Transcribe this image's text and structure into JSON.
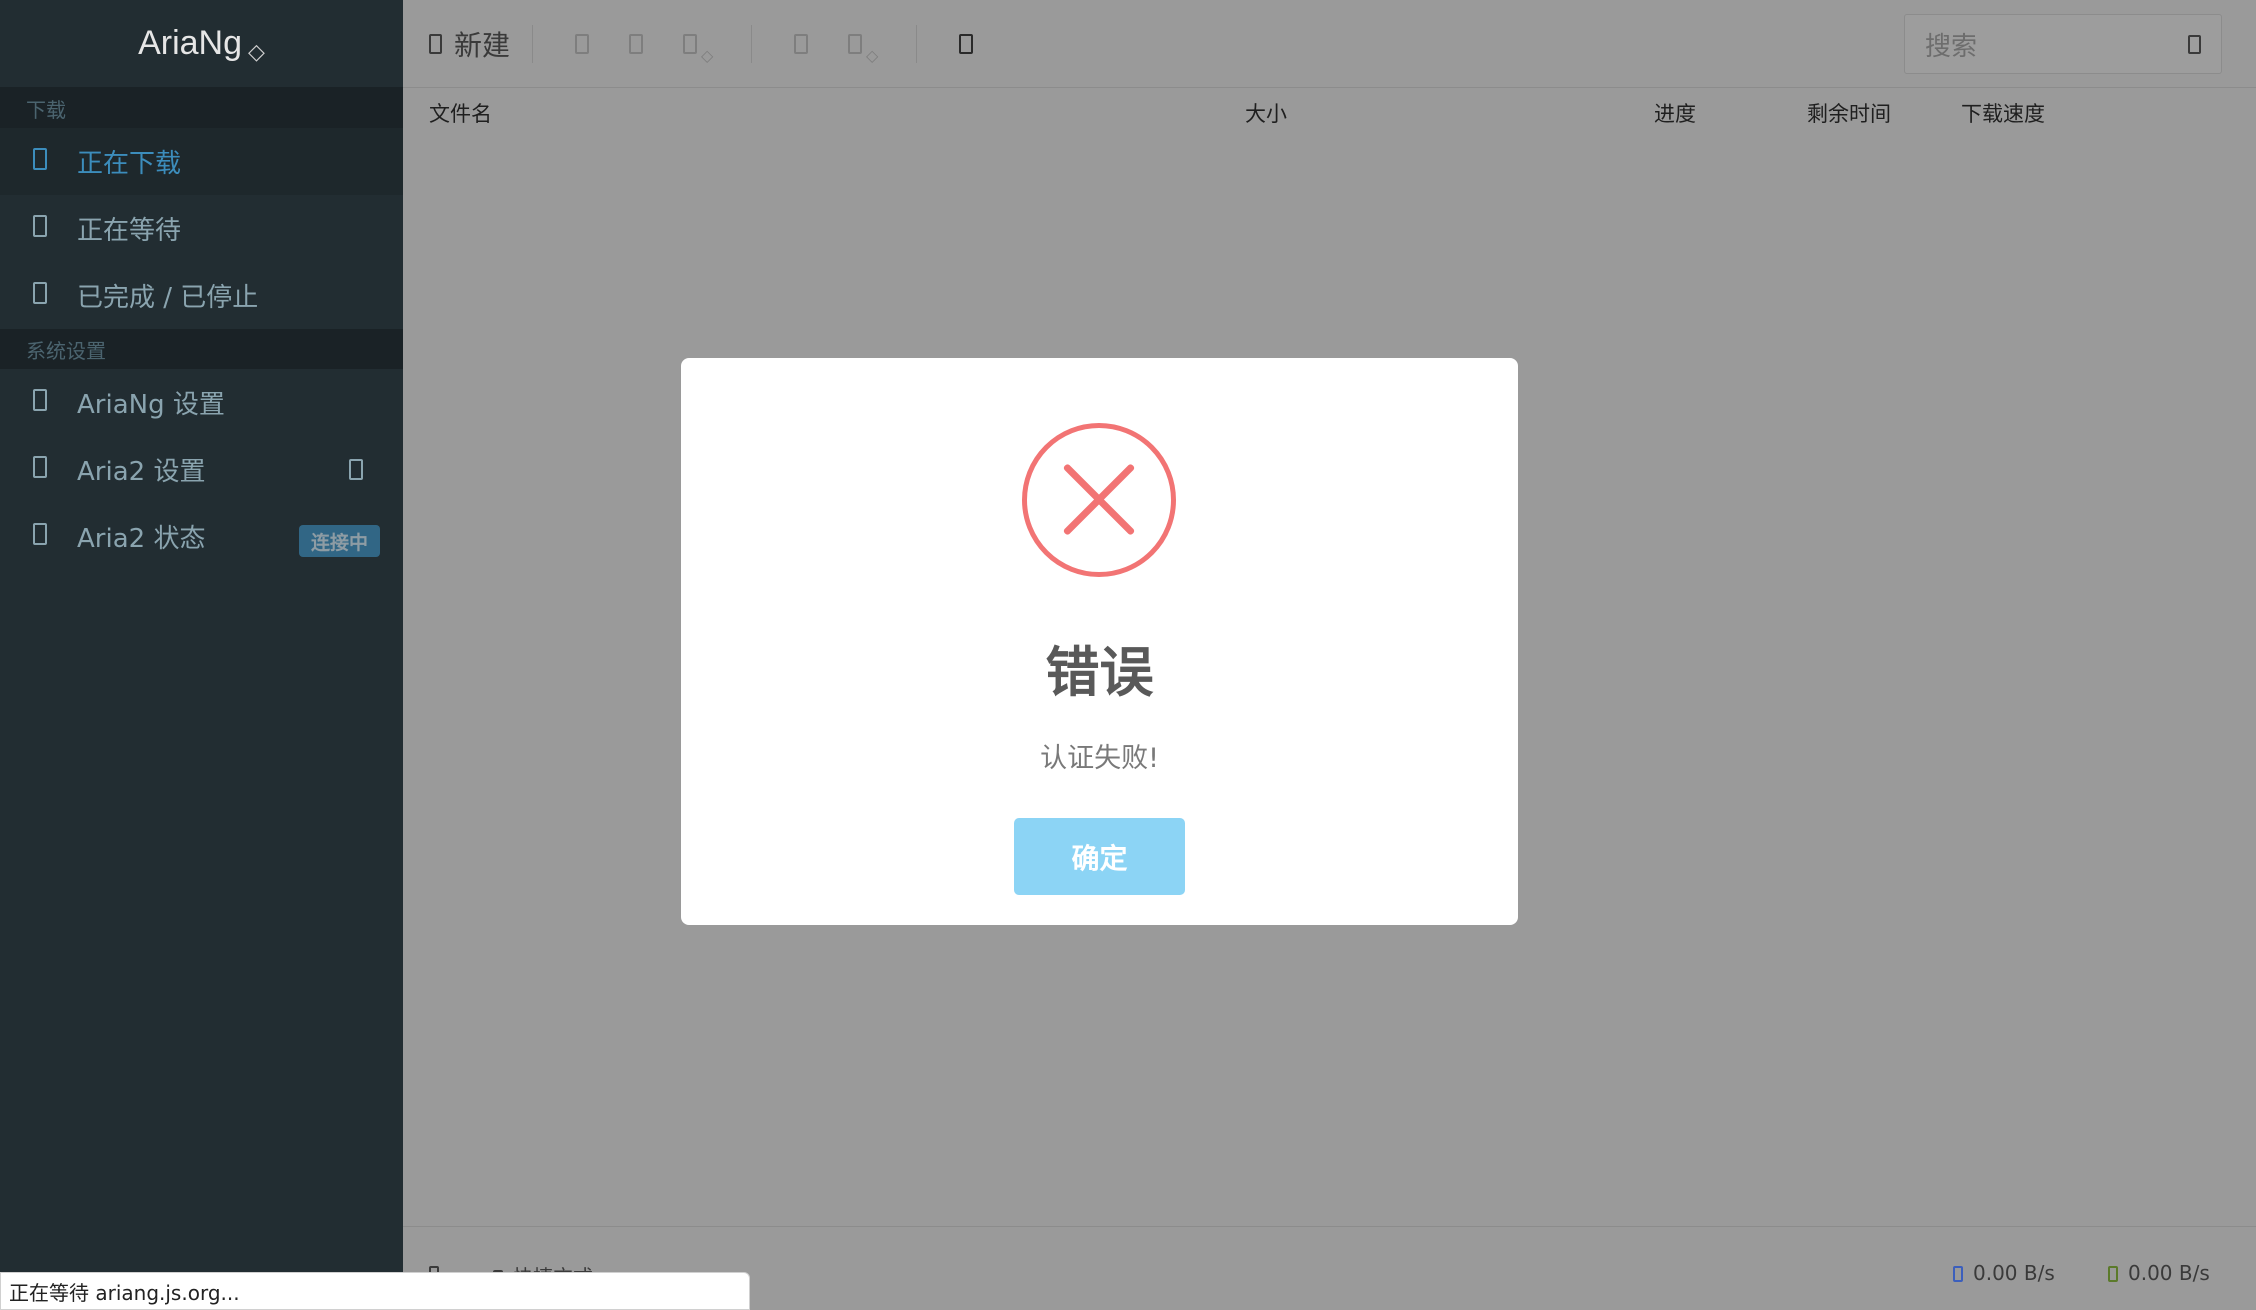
{
  "sidebar": {
    "brand": "AriaNg",
    "brand_suffix": "◇",
    "sections": [
      {
        "header": "下载"
      },
      {
        "header": "系统设置"
      }
    ],
    "downloads": [
      {
        "label": "正在下载"
      },
      {
        "label": "正在等待"
      },
      {
        "label": "已完成 / 已停止"
      }
    ],
    "settings": [
      {
        "label": "AriaNg 设置"
      },
      {
        "label": "Aria2 设置"
      },
      {
        "label": "Aria2 状态",
        "badge": "连接中"
      }
    ]
  },
  "toolbar": {
    "new_label": "新建",
    "search_placeholder": "搜索"
  },
  "table": {
    "columns": [
      "文件名",
      "大小",
      "进度",
      "剩余时间",
      "下载速度"
    ]
  },
  "footer": {
    "shortcut_label": "快捷方式",
    "download_speed": "0.00 B/s",
    "upload_speed": "0.00 B/s"
  },
  "statusbar": {
    "text": "正在等待 ariang.js.org..."
  },
  "dialog": {
    "title": "错误",
    "message": "认证失败!",
    "confirm_label": "确定"
  },
  "colors": {
    "error": "#f27474",
    "confirm_button": "#8cd4f5",
    "active_nav": "#3c8dbc",
    "sidebar_bg": "#222d32"
  }
}
